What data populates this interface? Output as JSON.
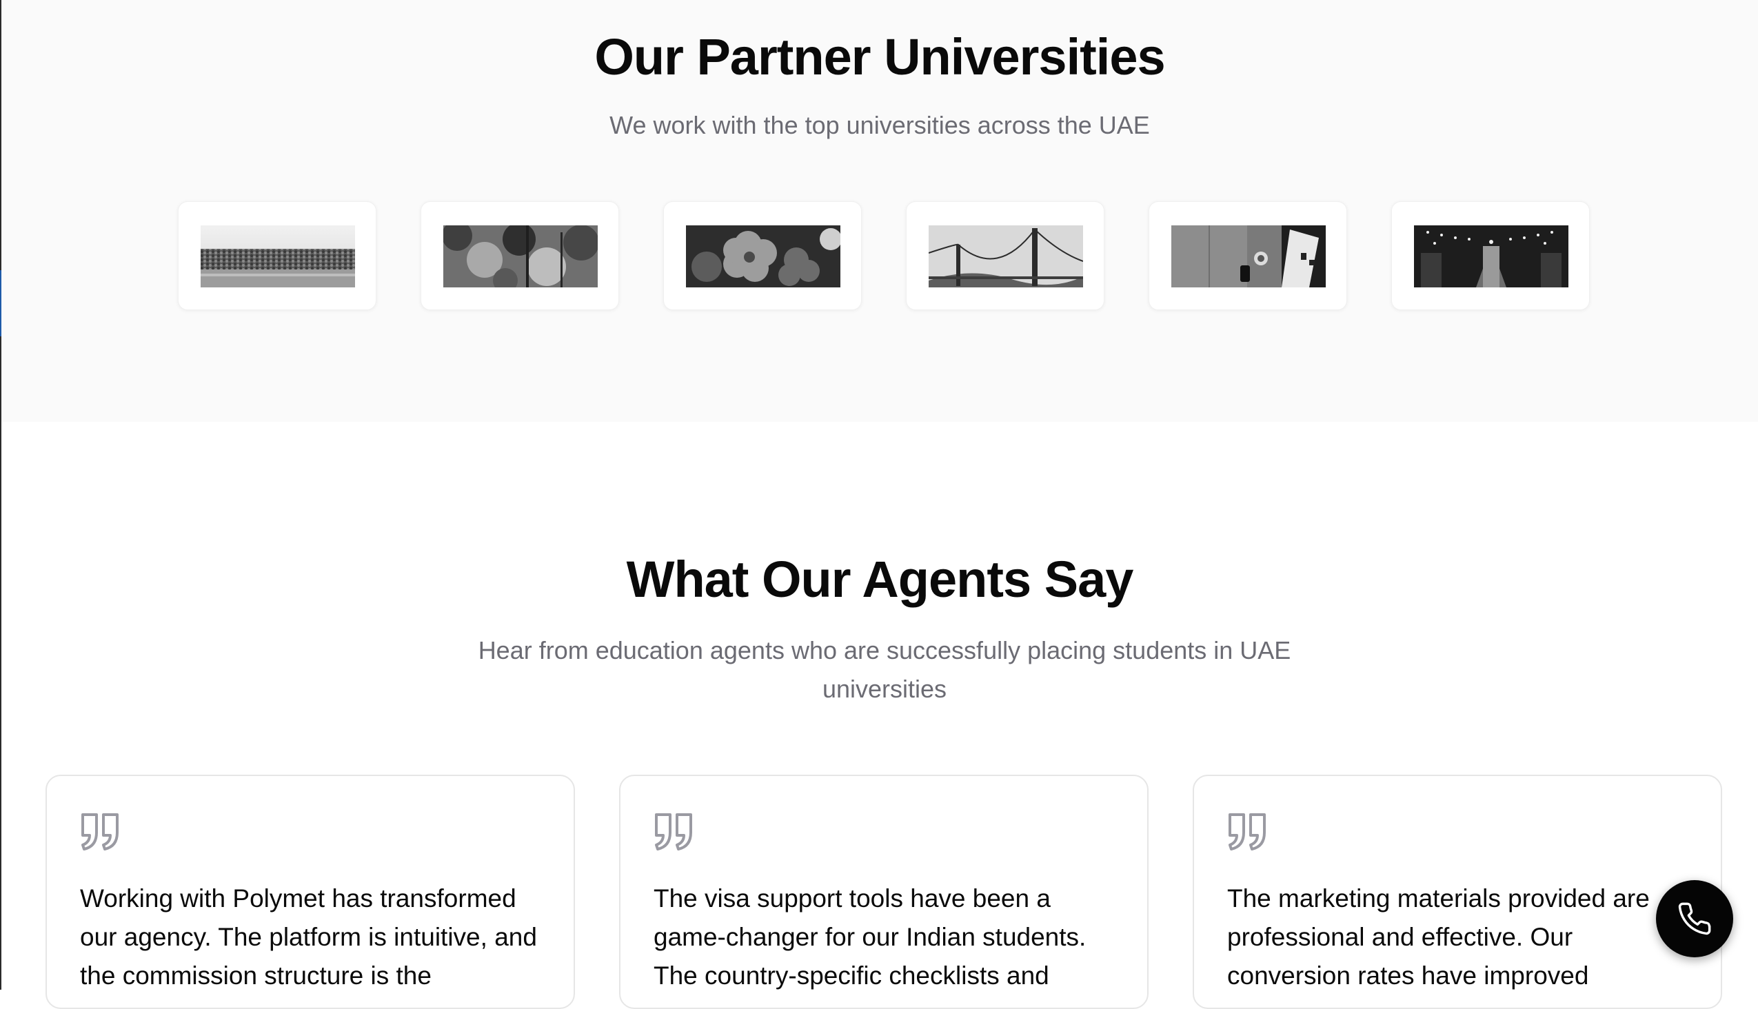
{
  "partners": {
    "title": "Our Partner Universities",
    "subtitle": "We work with the top universities across the UAE",
    "logos": [
      {
        "icon": "rocky-shore-photo"
      },
      {
        "icon": "tree-leaves-photo"
      },
      {
        "icon": "flowers-photo"
      },
      {
        "icon": "golden-gate-bridge-photo"
      },
      {
        "icon": "desk-items-photo"
      },
      {
        "icon": "string-lights-street-photo"
      }
    ]
  },
  "testimonials": {
    "title": "What Our Agents Say",
    "subtitle": "Hear from education agents who are successfully placing students in UAE universities",
    "items": [
      {
        "text": "Working with Polymet has transformed our agency. The platform is intuitive, and the commission structure is the"
      },
      {
        "text": "The visa support tools have been a game-changer for our Indian students. The country-specific checklists and"
      },
      {
        "text": "The marketing materials provided are professional and effective. Our conversion rates have improved"
      }
    ]
  },
  "call_button": {
    "icon": "phone-icon"
  },
  "colors": {
    "accent": "#050505",
    "muted_text": "#6b6b73",
    "section_bg": "#fafafa"
  }
}
